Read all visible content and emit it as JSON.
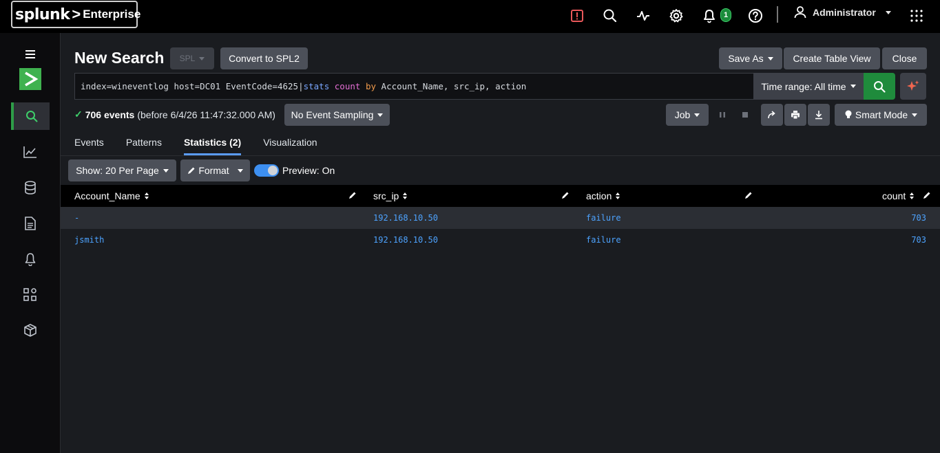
{
  "app": {
    "brand": "splunk",
    "product": "Enterprise",
    "user": "Administrator",
    "notification_count": "1",
    "colors": {
      "accent_green": "#1f8b3c",
      "link_blue": "#4da3ff",
      "tab_underline": "#5b9cf6",
      "alert_red": "#e9585a"
    }
  },
  "header": {
    "title": "New Search",
    "spl_label": "SPL",
    "convert_label": "Convert to SPL2",
    "save_as_label": "Save As",
    "create_table_label": "Create Table View",
    "close_label": "Close"
  },
  "search": {
    "query_index": "index=wineventlog host=DC01 EventCode=4625",
    "query_pipe": "|",
    "query_cmd": "stats",
    "query_fn": "count",
    "query_by": "by",
    "query_fields": "Account_Name, src_ip, action",
    "time_range_label": "Time range: All time"
  },
  "status": {
    "event_count": "706 events",
    "event_detail": "(before 6/4/26 11:47:32.000 AM)",
    "sampling_label": "No Event Sampling",
    "job_label": "Job",
    "mode_label": "Smart Mode"
  },
  "tabs": [
    {
      "label": "Events"
    },
    {
      "label": "Patterns"
    },
    {
      "label": "Statistics (2)"
    },
    {
      "label": "Visualization"
    }
  ],
  "toolbar": {
    "show_label": "Show: 20 Per Page",
    "format_label": "Format",
    "preview_label": "Preview: On"
  },
  "table": {
    "columns": [
      "Account_Name",
      "src_ip",
      "action",
      "count"
    ],
    "rows": [
      [
        "-",
        "192.168.10.50",
        "failure",
        "703"
      ],
      [
        "jsmith",
        "192.168.10.50",
        "failure",
        "703"
      ]
    ]
  }
}
